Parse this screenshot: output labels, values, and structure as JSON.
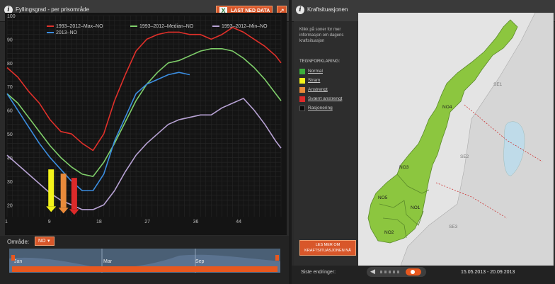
{
  "left_panel": {
    "title": "Fyllingsgrad - per prisområde",
    "download_label": "LAST NED DATA",
    "download_icon": "excel-x-icon",
    "external_icon": "external-link-icon",
    "omrade_label": "Område:",
    "omrade_value": "NO",
    "timeline_months": [
      "Jan",
      "Mar",
      "Sep"
    ]
  },
  "right_panel": {
    "title": "Kraftsituasjonen",
    "description": "Klikk på soner for mer informasjon om dagens kraftsituasjon",
    "legend_heading": "TEGNFORKLARING:",
    "legend": [
      {
        "label": "Normal",
        "color": "#3cae3c"
      },
      {
        "label": "Stram",
        "color": "#f3f31a"
      },
      {
        "label": "Anstrengt",
        "color": "#e98a3a"
      },
      {
        "label": "Sværrt anstrengt",
        "color": "#dd2a2a"
      },
      {
        "label": "Rasjonering",
        "color": "#0a0a0a"
      }
    ],
    "les_mer_label_1": "LES MER OM",
    "les_mer_label_2": "KRAFTSITUASJONEN NÅ",
    "siste_label": "Siste endringer:",
    "date_range": "15.05.2013 - 20.09.2013",
    "regions": {
      "no1": "NO1",
      "no2": "NO2",
      "no3": "NO3",
      "no4": "NO4",
      "no5": "NO5",
      "se1": "SE1",
      "se2": "SE2",
      "se3": "SE3"
    }
  },
  "colors": {
    "accent": "#d8572a",
    "max": "#e0302a",
    "median": "#7fcf6a",
    "min": "#b7a2d4",
    "current": "#3b8de0",
    "map_green": "#8cc63f"
  },
  "chart_data": {
    "type": "line",
    "x_ticks": [
      1,
      9,
      18,
      27,
      36,
      44
    ],
    "y_ticks": [
      20,
      30,
      40,
      50,
      60,
      70,
      80,
      90,
      100
    ],
    "ylim": [
      15,
      100
    ],
    "xlim": [
      1,
      52
    ],
    "series": [
      {
        "name": "1993–2012–Max–NO",
        "color": "#e0302a",
        "x": [
          1,
          3,
          5,
          7,
          9,
          11,
          13,
          15,
          17,
          19,
          21,
          23,
          25,
          27,
          29,
          31,
          33,
          35,
          37,
          39,
          41,
          43,
          45,
          47,
          49,
          51,
          52
        ],
        "y": [
          78,
          74,
          68,
          63,
          56,
          51,
          50,
          46,
          43,
          50,
          64,
          75,
          85,
          90,
          92,
          93,
          93,
          92,
          92,
          90,
          92,
          95,
          93,
          90,
          87,
          83,
          80
        ]
      },
      {
        "name": "1993–2012–Median–NO",
        "color": "#7fcf6a",
        "x": [
          1,
          3,
          5,
          7,
          9,
          11,
          13,
          15,
          17,
          19,
          21,
          23,
          25,
          27,
          29,
          31,
          33,
          35,
          37,
          39,
          41,
          43,
          45,
          47,
          49,
          51,
          52
        ],
        "y": [
          67,
          63,
          57,
          51,
          45,
          40,
          36,
          33,
          32,
          38,
          46,
          55,
          64,
          71,
          76,
          80,
          81,
          83,
          85,
          86,
          86,
          85,
          82,
          78,
          73,
          67,
          64
        ]
      },
      {
        "name": "1993–2012–Min–NO",
        "color": "#b7a2d4",
        "x": [
          1,
          3,
          5,
          7,
          9,
          11,
          13,
          15,
          17,
          19,
          21,
          23,
          25,
          27,
          29,
          31,
          33,
          35,
          37,
          39,
          41,
          43,
          45,
          47,
          49,
          51,
          52
        ],
        "y": [
          41,
          37,
          33,
          29,
          25,
          22,
          20,
          18,
          18,
          20,
          26,
          34,
          41,
          46,
          50,
          54,
          56,
          57,
          58,
          58,
          61,
          63,
          65,
          60,
          54,
          47,
          44
        ]
      },
      {
        "name": "2013–NO",
        "color": "#3b8de0",
        "x": [
          1,
          3,
          5,
          7,
          9,
          11,
          13,
          15,
          17,
          19,
          21,
          23,
          25,
          27,
          29,
          31,
          33,
          35
        ],
        "y": [
          67,
          60,
          53,
          46,
          40,
          35,
          30,
          26,
          26,
          33,
          47,
          57,
          67,
          71,
          73,
          75,
          76,
          75
        ]
      }
    ],
    "arrows": [
      {
        "x": 9.2,
        "color": "#f3f31a"
      },
      {
        "x": 11.5,
        "color": "#e98a3a"
      },
      {
        "x": 13.5,
        "color": "#dd2a2a"
      }
    ],
    "grid": true
  }
}
